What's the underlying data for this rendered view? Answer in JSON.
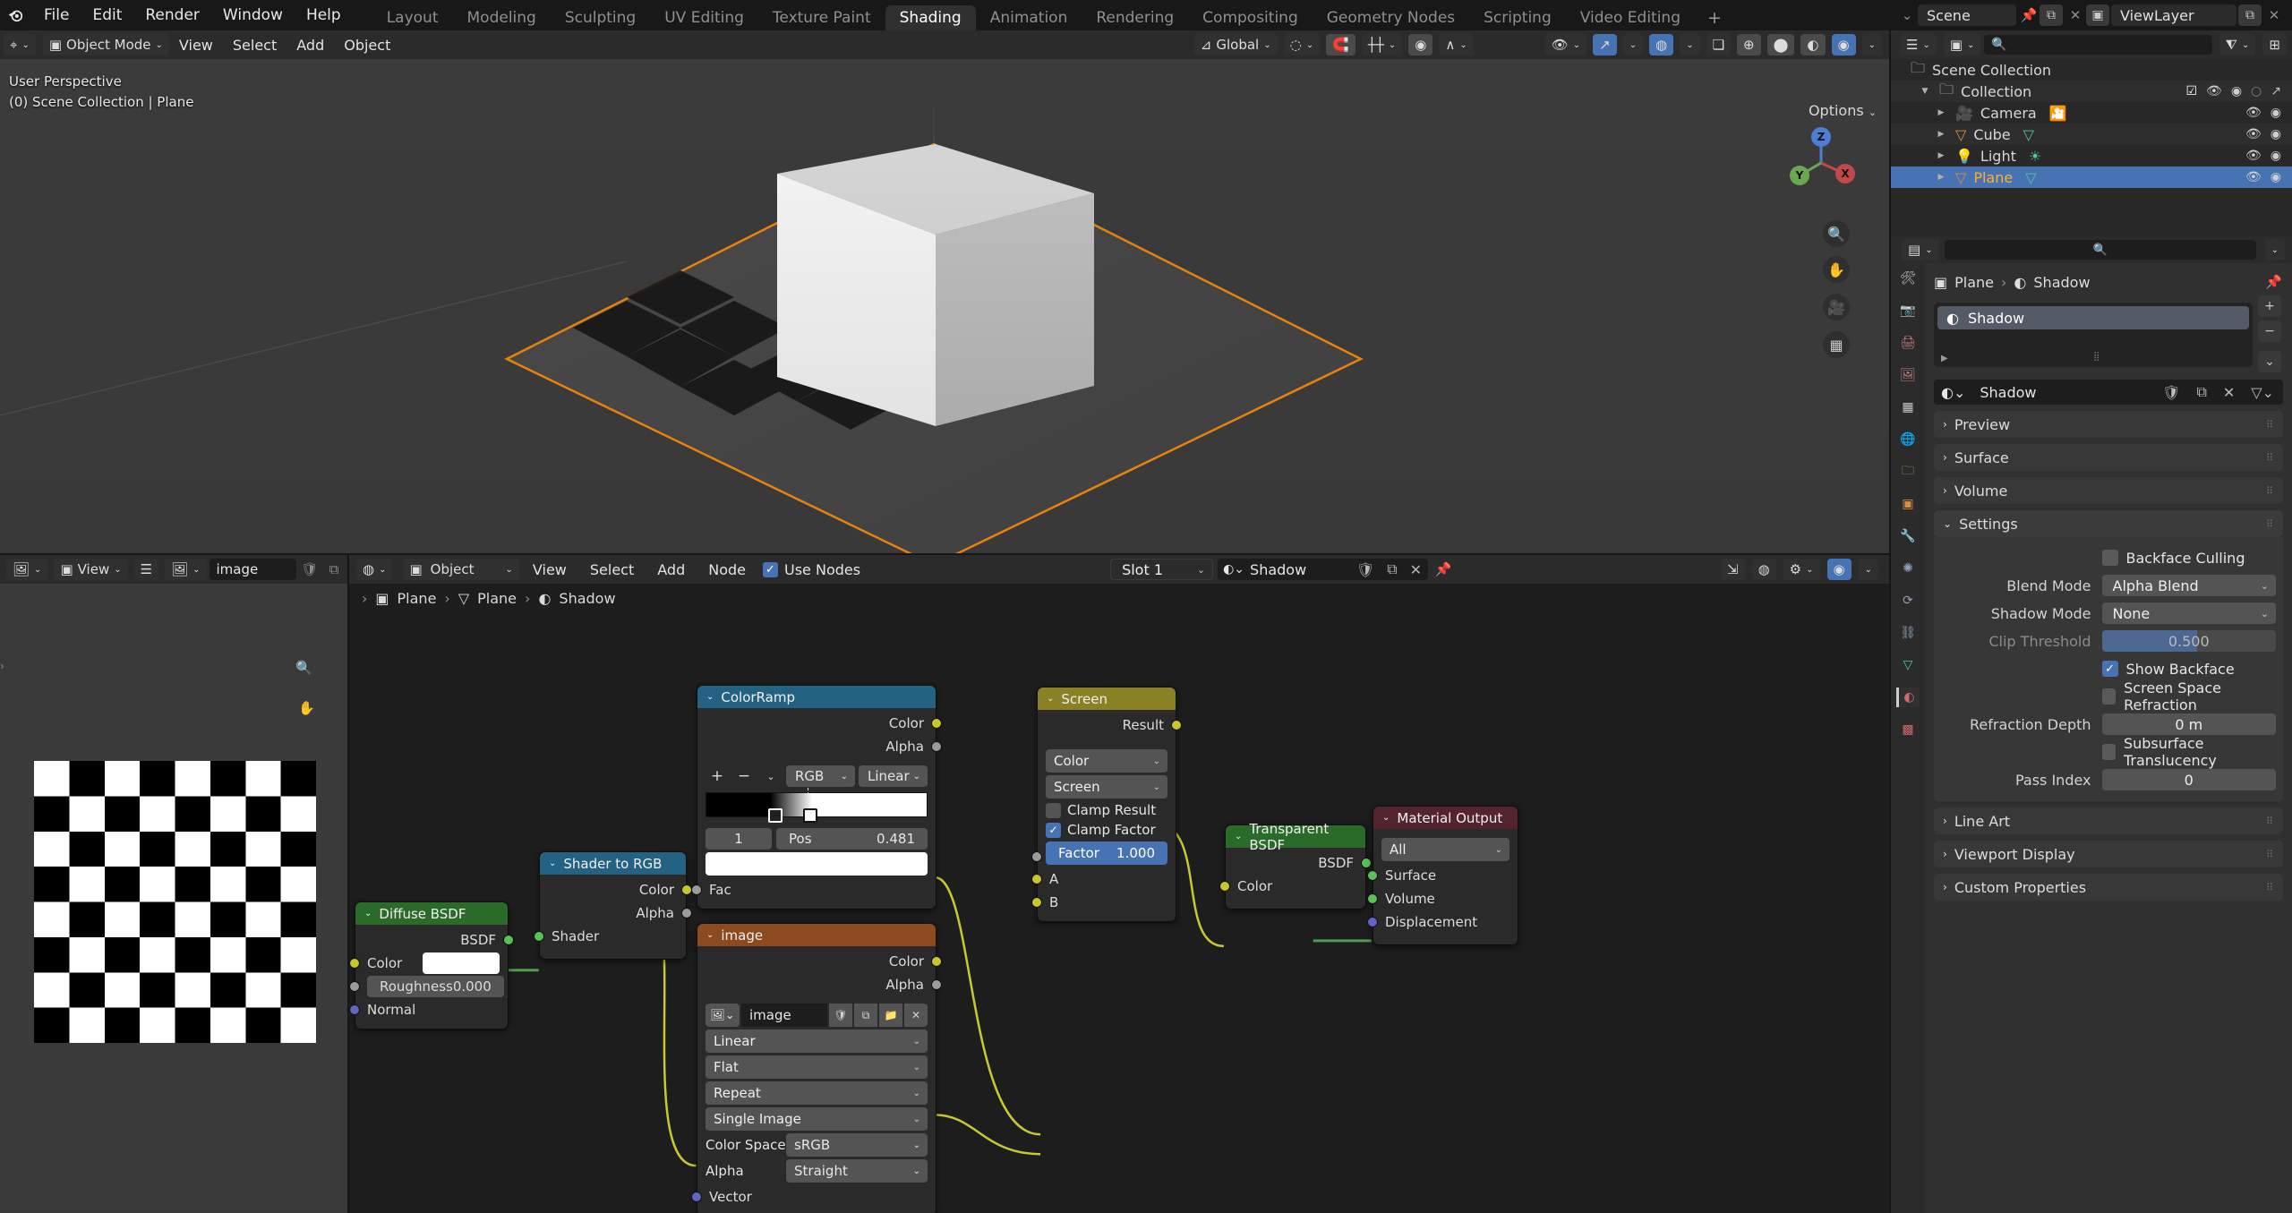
{
  "topbar": {
    "logo_icon": "blender-logo",
    "menus": [
      "File",
      "Edit",
      "Render",
      "Window",
      "Help"
    ],
    "workspaces": [
      "Layout",
      "Modeling",
      "Sculpting",
      "UV Editing",
      "Texture Paint",
      "Shading",
      "Animation",
      "Rendering",
      "Compositing",
      "Geometry Nodes",
      "Scripting",
      "Video Editing"
    ],
    "active_workspace": "Shading",
    "add_workspace_label": "+",
    "scene_name": "Scene",
    "viewlayer_name": "ViewLayer"
  },
  "viewport": {
    "mode": "Object Mode",
    "menus": [
      "View",
      "Select",
      "Add",
      "Object"
    ],
    "transform_orientation": "Global",
    "overlay_line1": "User Perspective",
    "overlay_line2": "(0) Scene Collection | Plane",
    "options_label": "Options",
    "gizmo_axes": [
      "X",
      "Y",
      "Z"
    ]
  },
  "outliner": {
    "search_placeholder": "",
    "rows": [
      {
        "label": "Scene Collection",
        "icon": "collection-icon",
        "depth": 0,
        "selected": false
      },
      {
        "label": "Collection",
        "icon": "collection-icon",
        "depth": 1,
        "selected": false
      },
      {
        "label": "Camera",
        "icon": "camera-icon",
        "depth": 2,
        "selected": false
      },
      {
        "label": "Cube",
        "icon": "mesh-icon",
        "depth": 2,
        "selected": false
      },
      {
        "label": "Light",
        "icon": "light-icon",
        "depth": 2,
        "selected": false
      },
      {
        "label": "Plane",
        "icon": "mesh-icon",
        "depth": 2,
        "selected": true
      }
    ]
  },
  "properties": {
    "breadcrumb": [
      "Plane",
      "Shadow"
    ],
    "material_slot": "Shadow",
    "material_name": "Shadow",
    "panels": [
      {
        "label": "Preview",
        "open": false
      },
      {
        "label": "Surface",
        "open": false
      },
      {
        "label": "Volume",
        "open": false
      },
      {
        "label": "Settings",
        "open": true
      }
    ],
    "settings": {
      "backface_culling_label": "Backface Culling",
      "backface_culling": false,
      "blend_mode_label": "Blend Mode",
      "blend_mode": "Alpha Blend",
      "shadow_mode_label": "Shadow Mode",
      "shadow_mode": "None",
      "clip_threshold_label": "Clip Threshold",
      "clip_threshold": "0.500",
      "show_backface_label": "Show Backface",
      "show_backface": true,
      "ssr_label": "Screen Space Refraction",
      "ssr": false,
      "refraction_depth_label": "Refraction Depth",
      "refraction_depth": "0 m",
      "subsurface_label": "Subsurface Translucency",
      "subsurface": false,
      "pass_index_label": "Pass Index",
      "pass_index": "0"
    },
    "bottom_panels": [
      {
        "label": "Line Art"
      },
      {
        "label": "Viewport Display"
      },
      {
        "label": "Custom Properties"
      }
    ]
  },
  "image_editor": {
    "view_menu": "View",
    "image_name": "image"
  },
  "shader_editor": {
    "object_mode": "Object",
    "menus": [
      "View",
      "Select",
      "Add",
      "Node"
    ],
    "use_nodes_label": "Use Nodes",
    "use_nodes": true,
    "slot": "Slot 1",
    "material": "Shadow",
    "breadcrumb": [
      "Plane",
      "Plane",
      "Shadow"
    ],
    "nodes": {
      "diffuse": {
        "title": "Diffuse BSDF",
        "header_color": "#2a6b2a",
        "outputs": [
          "BSDF"
        ],
        "color_label": "Color",
        "color_value": "#ffffff",
        "roughness_label": "Roughness",
        "roughness_value": "0.000",
        "normal_label": "Normal"
      },
      "shader_to_rgb": {
        "title": "Shader to RGB",
        "header_color": "#246283",
        "outputs": [
          "Color",
          "Alpha"
        ],
        "inputs": [
          "Shader"
        ]
      },
      "colorramp": {
        "title": "ColorRamp",
        "header_color": "#246283",
        "outputs": [
          "Color",
          "Alpha"
        ],
        "add_label": "+",
        "remove_label": "−",
        "color_mode": "RGB",
        "interpolation": "Linear",
        "index": "1",
        "pos_label": "Pos",
        "pos_value": "0.481",
        "swatch": "#ffffff",
        "inputs": [
          "Fac"
        ]
      },
      "image": {
        "title": "image",
        "header_color": "#8c4a1e",
        "outputs": [
          "Color",
          "Alpha"
        ],
        "datablock_name": "image",
        "interpolation": "Linear",
        "projection": "Flat",
        "extension": "Repeat",
        "source": "Single Image",
        "color_space_label": "Color Space",
        "color_space": "sRGB",
        "alpha_label": "Alpha",
        "alpha": "Straight",
        "inputs": [
          "Vector"
        ]
      },
      "screen": {
        "title": "Screen",
        "header_color": "#8a8024",
        "outputs": [
          "Result"
        ],
        "data_type": "Color",
        "blend_mode": "Screen",
        "clamp_result_label": "Clamp Result",
        "clamp_result": false,
        "clamp_factor_label": "Clamp Factor",
        "clamp_factor": true,
        "factor_label": "Factor",
        "factor_value": "1.000",
        "inputs": [
          "A",
          "B"
        ]
      },
      "transparent": {
        "title": "Transparent BSDF",
        "header_color": "#2a6b2a",
        "outputs": [
          "BSDF"
        ],
        "inputs": [
          "Color"
        ]
      },
      "material_output": {
        "title": "Material Output",
        "header_color": "#54242e",
        "target": "All",
        "inputs": [
          "Surface",
          "Volume",
          "Displacement"
        ]
      }
    }
  }
}
